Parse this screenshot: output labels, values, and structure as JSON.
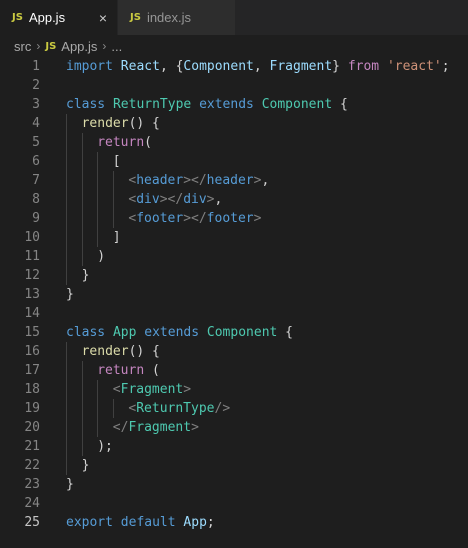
{
  "tabs": [
    {
      "icon": "JS",
      "label": "App.js",
      "close": "×"
    },
    {
      "icon": "JS",
      "label": "index.js"
    }
  ],
  "breadcrumb": {
    "folder": "src",
    "file_icon": "JS",
    "file": "App.js",
    "more": "..."
  },
  "lines": [
    {
      "n": "1",
      "indent": 0,
      "tokens": [
        [
          "kw",
          "import"
        ],
        [
          "pun",
          " "
        ],
        [
          "var",
          "React"
        ],
        [
          "pun",
          ", {"
        ],
        [
          "var",
          "Component"
        ],
        [
          "pun",
          ", "
        ],
        [
          "var",
          "Fragment"
        ],
        [
          "pun",
          "} "
        ],
        [
          "ctl",
          "from"
        ],
        [
          "pun",
          " "
        ],
        [
          "str",
          "'react'"
        ],
        [
          "pun",
          ";"
        ]
      ]
    },
    {
      "n": "2",
      "indent": 0,
      "tokens": []
    },
    {
      "n": "3",
      "indent": 0,
      "tokens": [
        [
          "kw",
          "class"
        ],
        [
          "pun",
          " "
        ],
        [
          "cls",
          "ReturnType"
        ],
        [
          "pun",
          " "
        ],
        [
          "kw",
          "extends"
        ],
        [
          "pun",
          " "
        ],
        [
          "cls",
          "Component"
        ],
        [
          "pun",
          " {"
        ]
      ]
    },
    {
      "n": "4",
      "indent": 1,
      "tokens": [
        [
          "fn",
          "render"
        ],
        [
          "pun",
          "() {"
        ]
      ]
    },
    {
      "n": "5",
      "indent": 2,
      "tokens": [
        [
          "ctl",
          "return"
        ],
        [
          "pun",
          "("
        ]
      ]
    },
    {
      "n": "6",
      "indent": 3,
      "tokens": [
        [
          "pun",
          "["
        ]
      ]
    },
    {
      "n": "7",
      "indent": 4,
      "tokens": [
        [
          "tagb",
          "<"
        ],
        [
          "tag",
          "header"
        ],
        [
          "tagb",
          "></"
        ],
        [
          "tag",
          "header"
        ],
        [
          "tagb",
          ">"
        ],
        [
          "pun",
          ","
        ]
      ]
    },
    {
      "n": "8",
      "indent": 4,
      "tokens": [
        [
          "tagb",
          "<"
        ],
        [
          "tag",
          "div"
        ],
        [
          "tagb",
          "></"
        ],
        [
          "tag",
          "div"
        ],
        [
          "tagb",
          ">"
        ],
        [
          "pun",
          ","
        ]
      ]
    },
    {
      "n": "9",
      "indent": 4,
      "tokens": [
        [
          "tagb",
          "<"
        ],
        [
          "tag",
          "footer"
        ],
        [
          "tagb",
          "></"
        ],
        [
          "tag",
          "footer"
        ],
        [
          "tagb",
          ">"
        ]
      ]
    },
    {
      "n": "10",
      "indent": 3,
      "tokens": [
        [
          "pun",
          "]"
        ]
      ]
    },
    {
      "n": "11",
      "indent": 2,
      "tokens": [
        [
          "pun",
          ")"
        ]
      ]
    },
    {
      "n": "12",
      "indent": 1,
      "tokens": [
        [
          "pun",
          "}"
        ]
      ]
    },
    {
      "n": "13",
      "indent": 0,
      "tokens": [
        [
          "pun",
          "}"
        ]
      ]
    },
    {
      "n": "14",
      "indent": 0,
      "tokens": []
    },
    {
      "n": "15",
      "indent": 0,
      "tokens": [
        [
          "kw",
          "class"
        ],
        [
          "pun",
          " "
        ],
        [
          "cls",
          "App"
        ],
        [
          "pun",
          " "
        ],
        [
          "kw",
          "extends"
        ],
        [
          "pun",
          " "
        ],
        [
          "cls",
          "Component"
        ],
        [
          "pun",
          " {"
        ]
      ]
    },
    {
      "n": "16",
      "indent": 1,
      "tokens": [
        [
          "fn",
          "render"
        ],
        [
          "pun",
          "() {"
        ]
      ]
    },
    {
      "n": "17",
      "indent": 2,
      "tokens": [
        [
          "ctl",
          "return"
        ],
        [
          "pun",
          " ("
        ]
      ]
    },
    {
      "n": "18",
      "indent": 3,
      "tokens": [
        [
          "tagb",
          "<"
        ],
        [
          "cls",
          "Fragment"
        ],
        [
          "tagb",
          ">"
        ]
      ]
    },
    {
      "n": "19",
      "indent": 4,
      "tokens": [
        [
          "tagb",
          "<"
        ],
        [
          "cls",
          "ReturnType"
        ],
        [
          "tagb",
          "/>"
        ]
      ]
    },
    {
      "n": "20",
      "indent": 3,
      "tokens": [
        [
          "tagb",
          "</"
        ],
        [
          "cls",
          "Fragment"
        ],
        [
          "tagb",
          ">"
        ]
      ]
    },
    {
      "n": "21",
      "indent": 2,
      "tokens": [
        [
          "pun",
          ");"
        ]
      ]
    },
    {
      "n": "22",
      "indent": 1,
      "tokens": [
        [
          "pun",
          "}"
        ]
      ]
    },
    {
      "n": "23",
      "indent": 0,
      "tokens": [
        [
          "pun",
          "}"
        ]
      ]
    },
    {
      "n": "24",
      "indent": 0,
      "tokens": []
    },
    {
      "n": "25",
      "indent": 0,
      "current": true,
      "tokens": [
        [
          "kw",
          "export"
        ],
        [
          "pun",
          " "
        ],
        [
          "kw",
          "default"
        ],
        [
          "pun",
          " "
        ],
        [
          "var",
          "App"
        ],
        [
          "pun",
          ";"
        ]
      ]
    }
  ]
}
